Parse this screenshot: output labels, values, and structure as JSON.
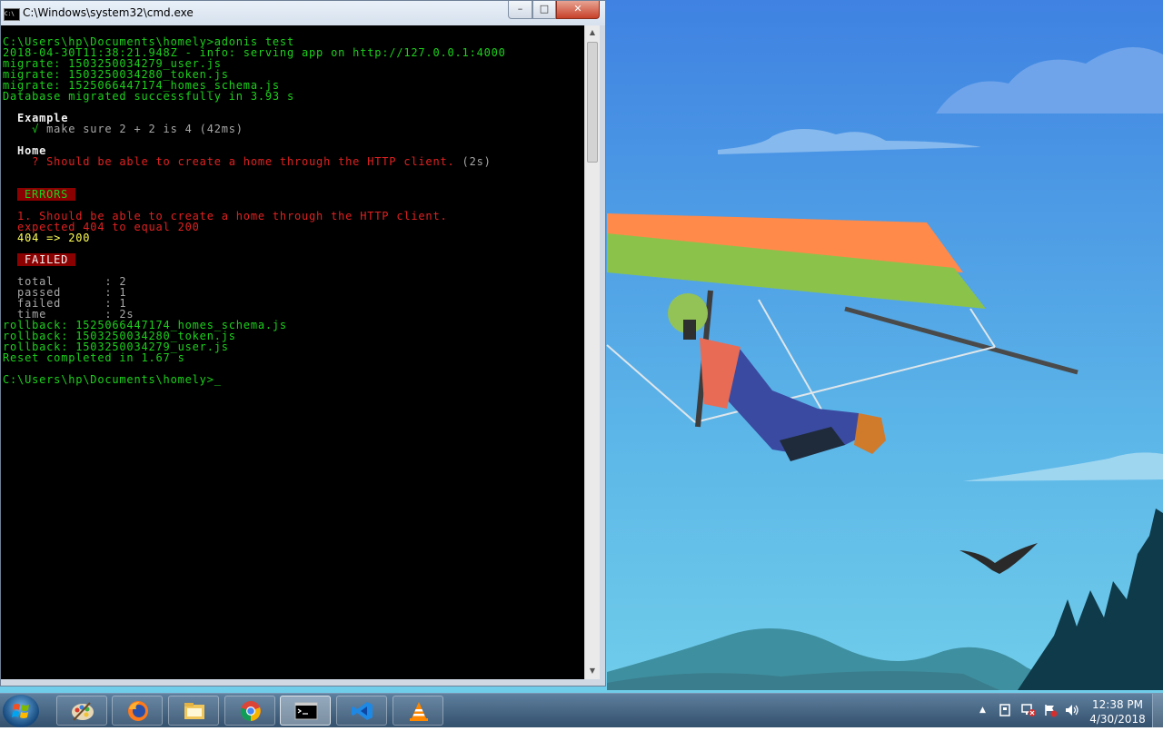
{
  "window": {
    "title": "C:\\Windows\\system32\\cmd.exe",
    "icon_text": "C:\\"
  },
  "controls": {
    "minimize": "–",
    "maximize": "□",
    "close": "✕"
  },
  "console": {
    "line01": "C:\\Users\\hp\\Documents\\homely>adonis test",
    "line02": "2018-04-30T11:38:21.948Z - info: serving app on http://127.0.0.1:4000",
    "line03": "migrate: 1503250034279_user.js",
    "line04": "migrate: 1503250034280_token.js",
    "line05": "migrate: 1525066447174_homes_schema.js",
    "line06": "Database migrated successfully in 3.93 s",
    "line07": "  Example",
    "line08_mark": "    √ ",
    "line08_text": "make sure 2 + 2 is 4 (42ms)",
    "line09": "  Home",
    "line10_mark": "    ? Should be able to create a home through the HTTP client.",
    "line10_time": " (2s)",
    "errors_badge": " ERRORS ",
    "line11": "  1. Should be able to create a home through the HTTP client.",
    "line12": "  expected 404 to equal 200",
    "line13": "  404 => 200",
    "failed_badge": " FAILED ",
    "line14": "  total       : 2",
    "line15": "  passed      : 1",
    "line16": "  failed      : 1",
    "line17": "  time        : 2s",
    "line18": "rollback: 1525066447174_homes_schema.js",
    "line19": "rollback: 1503250034280_token.js",
    "line20": "rollback: 1503250034279_user.js",
    "line21": "Reset completed in 1.67 s",
    "line22": "C:\\Users\\hp\\Documents\\homely>_"
  },
  "taskbar": {
    "apps": [
      "paint-icon",
      "firefox-icon",
      "file-explorer-icon",
      "chrome-icon",
      "cmd-icon",
      "vscode-icon",
      "vlc-icon"
    ],
    "active_app": "cmd-icon",
    "tray": {
      "expand": "▲"
    },
    "clock": {
      "time": "12:38 PM",
      "date": "4/30/2018"
    }
  },
  "colors": {
    "console_green": "#1cd11c",
    "console_red": "#e02121",
    "console_yellow": "#ffff57",
    "badge_bg": "#8b0000",
    "sky_top": "#3f82e2",
    "sky_bottom": "#73d0ea"
  }
}
